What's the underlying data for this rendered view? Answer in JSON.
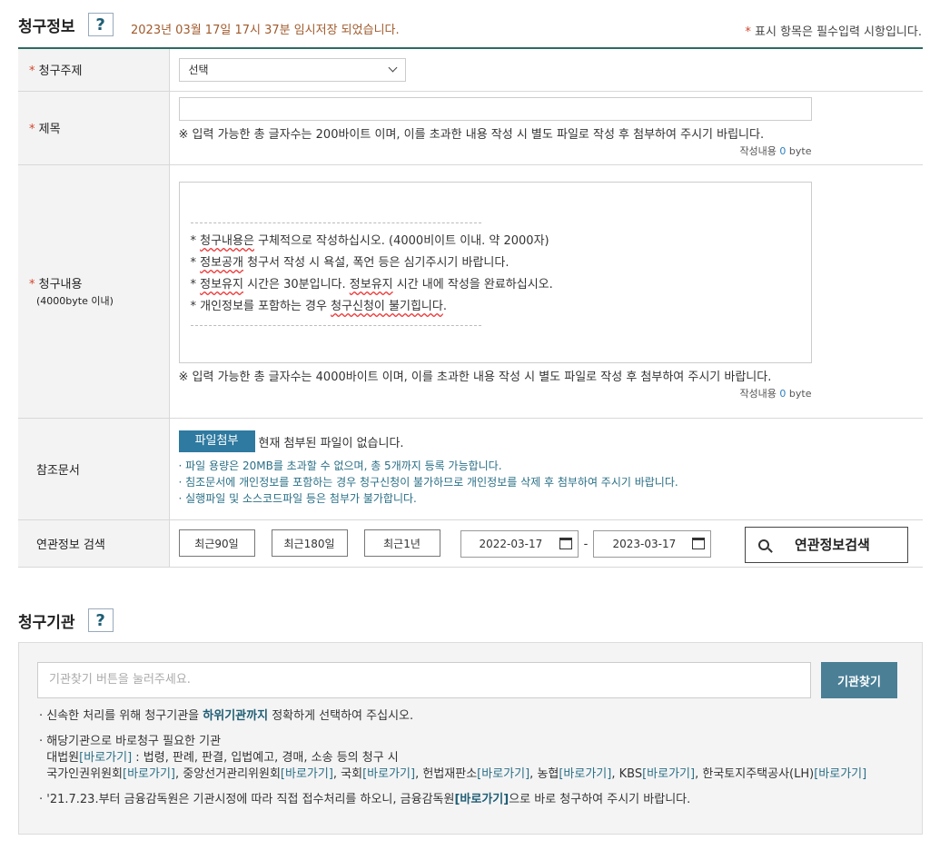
{
  "section1": {
    "title": "청구정보",
    "help": "?",
    "autosave": "2023년 03월 17일 17시 37분 임시저장 되었습니다.",
    "required_star": "*",
    "required_note": "표시 항목은 필수입력 시항입니다."
  },
  "rows": {
    "subject_label": "청구주제",
    "subject_value": "선택",
    "title_label": "제목",
    "title_note": "※ 입력 가능한 총 글자수는 200바이트 이며, 이를 초과한 내용 작성 시 별도 파일로 작성 후 첨부하여 주시기 바립니다.",
    "title_count_prefix": "작성내용",
    "title_count": "0",
    "title_count_unit": "byte",
    "content_label": "청구내용",
    "content_sublabel": "(4000byte 이내)",
    "content_lines": [
      "* 청구내용은 구체적으로 작성하십시오. (4000비이트 이내. 약 2000자)",
      "* 정보공개 청구서 작성 시 욕설, 폭언 등은 심기주시기 바랍니다.",
      "* 정보유지 시간은 30분입니다. 정보유지 시간 내에 작성을 완료하십시오.",
      "* 개인정보를 포함하는 경우 청구신청이 불기힙니다."
    ],
    "content_note": "※ 입력 가능한 총 글자수는 4000바이트 이며, 이를 초과한 내용 작성 시 별도 파일로 작성 후 첨부하여 주시기 바랍니다.",
    "content_count_prefix": "작성내용",
    "content_count": "0",
    "content_count_unit": "byte",
    "attach_label": "참조문서",
    "attach_button": "파일첨부",
    "attach_status": "현재 첨부된 파일이 없습니다.",
    "attach_notes": [
      "· 파일 용량은 20MB를 초과할 수 없으며, 총 5개까지 등록 가능합니다.",
      "· 침조문서에 개인정보를 포함하는 경우 청구신청이 불가하므로 개인정보를 삭제 후 첨부하여 주시기 바랍니다.",
      "· 실행파일 및 소스코드파일 등은 첨부가 불가합니다."
    ],
    "related_label": "연관정보 검색",
    "period_buttons": [
      "최근90일",
      "최근180일",
      "최근1년"
    ],
    "date_from": "2022-03-17",
    "date_sep": "-",
    "date_to": "2023-03-17",
    "search_button": "연관정보검색"
  },
  "section2": {
    "title": "청구기관",
    "help": "?",
    "placeholder": "기관찾기 버튼을 눌러주세요.",
    "find_button": "기관찾기",
    "note1_pre": "· 신속한 처리를 위해 청구기관을",
    "note1_bold": "하위기관까지",
    "note1_post": "정확하게 선택하여 주십시오.",
    "note2_title": "· 해당기관으로 바로청구 필요한 기관",
    "note2_line1_pre": "대법원",
    "note2_line1_link": "[바로가기]",
    "note2_line1_post": ": 법령, 판례, 판결, 입법예고, 경매, 소송 등의 청구 시",
    "orgs": [
      {
        "name": "국가인권위원회",
        "link": "[바로가기]",
        "sep": ","
      },
      {
        "name": "중앙선거관리위원회",
        "link": "[바로가기]",
        "sep": ","
      },
      {
        "name": "국회",
        "link": "[바로가기]",
        "sep": ","
      },
      {
        "name": "헌법재판소",
        "link": "[바로가기]",
        "sep": ","
      },
      {
        "name": "농협",
        "link": "[바로가기]",
        "sep": ","
      },
      {
        "name": "KBS",
        "link": "[바로가기]",
        "sep": ","
      },
      {
        "name": "한국토지주택공사(LH)",
        "link": "[바로가기]",
        "sep": ""
      }
    ],
    "note3_pre": "· '21.7.23.부터 금융감독원은 기관시정에 따라 직접 접수처리를 하오니, 금융감독원",
    "note3_link": "[바로가기]",
    "note3_post": "으로 바로 청구하여 주시기 바랍니다."
  }
}
